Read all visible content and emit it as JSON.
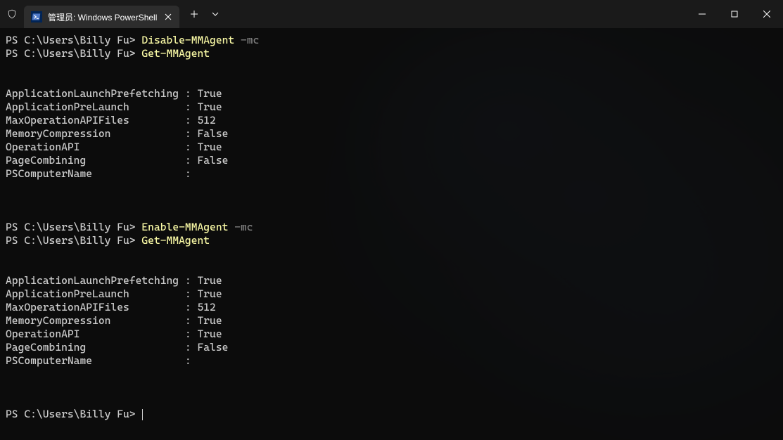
{
  "window": {
    "tab_title": "管理员: Windows PowerShell",
    "tab_icon_label": ">_"
  },
  "prompt": "PS C:\\Users\\Billy Fu>",
  "commands": {
    "disable": "Disable-MMAgent",
    "get": "Get-MMAgent",
    "enable": "Enable-MMAgent",
    "arg_mc": "-mc"
  },
  "output_block1": {
    "rows": [
      {
        "key": "ApplicationLaunchPrefetching",
        "val": "True"
      },
      {
        "key": "ApplicationPreLaunch",
        "val": "True"
      },
      {
        "key": "MaxOperationAPIFiles",
        "val": "512"
      },
      {
        "key": "MemoryCompression",
        "val": "False"
      },
      {
        "key": "OperationAPI",
        "val": "True"
      },
      {
        "key": "PageCombining",
        "val": "False"
      },
      {
        "key": "PSComputerName",
        "val": ""
      }
    ]
  },
  "output_block2": {
    "rows": [
      {
        "key": "ApplicationLaunchPrefetching",
        "val": "True"
      },
      {
        "key": "ApplicationPreLaunch",
        "val": "True"
      },
      {
        "key": "MaxOperationAPIFiles",
        "val": "512"
      },
      {
        "key": "MemoryCompression",
        "val": "True"
      },
      {
        "key": "OperationAPI",
        "val": "True"
      },
      {
        "key": "PageCombining",
        "val": "False"
      },
      {
        "key": "PSComputerName",
        "val": ""
      }
    ]
  }
}
